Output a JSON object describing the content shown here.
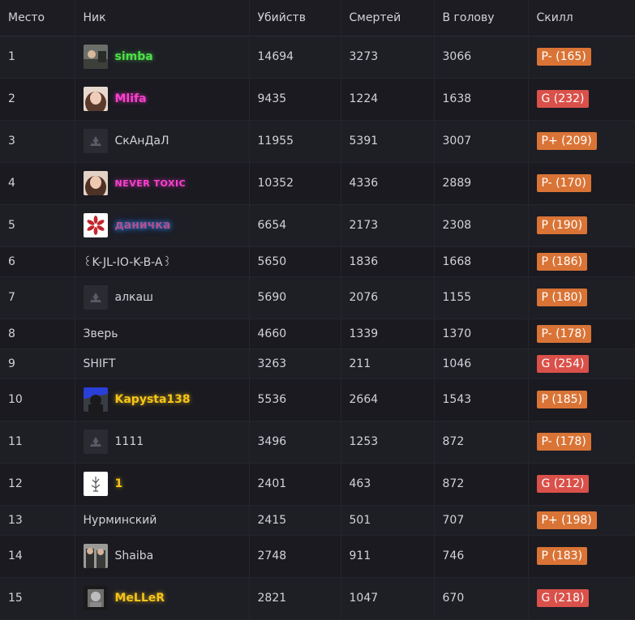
{
  "columns": [
    "Место",
    "Ник",
    "Убийств",
    "Смертей",
    "В голову",
    "Скилл"
  ],
  "colors": {
    "badge_p": "#d97436",
    "badge_g": "#d9514a"
  },
  "rows": [
    {
      "place": "1",
      "nick": "simba",
      "kills": "14694",
      "deaths": "3273",
      "headshots": "3066",
      "skill": "P- (165)"
    },
    {
      "place": "2",
      "nick": "Mlifa",
      "kills": "9435",
      "deaths": "1224",
      "headshots": "1638",
      "skill": "G (232)"
    },
    {
      "place": "3",
      "nick": "СкАнДаЛ",
      "kills": "11955",
      "deaths": "5391",
      "headshots": "3007",
      "skill": "P+ (209)"
    },
    {
      "place": "4",
      "nick": "NEVER TOXIC",
      "kills": "10352",
      "deaths": "4336",
      "headshots": "2889",
      "skill": "P- (170)"
    },
    {
      "place": "5",
      "nick": "даничка",
      "kills": "6654",
      "deaths": "2173",
      "headshots": "2308",
      "skill": "P (190)"
    },
    {
      "place": "6",
      "nick": "꒰K-JL-IO-K-B-A꒱",
      "kills": "5650",
      "deaths": "1836",
      "headshots": "1668",
      "skill": "P (186)"
    },
    {
      "place": "7",
      "nick": "алкаш",
      "kills": "5690",
      "deaths": "2076",
      "headshots": "1155",
      "skill": "P (180)"
    },
    {
      "place": "8",
      "nick": "Зверь",
      "kills": "4660",
      "deaths": "1339",
      "headshots": "1370",
      "skill": "P- (178)"
    },
    {
      "place": "9",
      "nick": "SHIFT",
      "kills": "3263",
      "deaths": "211",
      "headshots": "1046",
      "skill": "G (254)"
    },
    {
      "place": "10",
      "nick": "Kapysta138",
      "kills": "5536",
      "deaths": "2664",
      "headshots": "1543",
      "skill": "P (185)"
    },
    {
      "place": "11",
      "nick": "1111",
      "kills": "3496",
      "deaths": "1253",
      "headshots": "872",
      "skill": "P- (178)"
    },
    {
      "place": "12",
      "nick": "1",
      "kills": "2401",
      "deaths": "463",
      "headshots": "872",
      "skill": "G (212)"
    },
    {
      "place": "13",
      "nick": "Нурминский",
      "kills": "2415",
      "deaths": "501",
      "headshots": "707",
      "skill": "P+ (198)"
    },
    {
      "place": "14",
      "nick": "Shaiba",
      "kills": "2748",
      "deaths": "911",
      "headshots": "746",
      "skill": "P (183)"
    },
    {
      "place": "15",
      "nick": "MeLLeR",
      "kills": "2821",
      "deaths": "1047",
      "headshots": "670",
      "skill": "G (218)"
    }
  ]
}
